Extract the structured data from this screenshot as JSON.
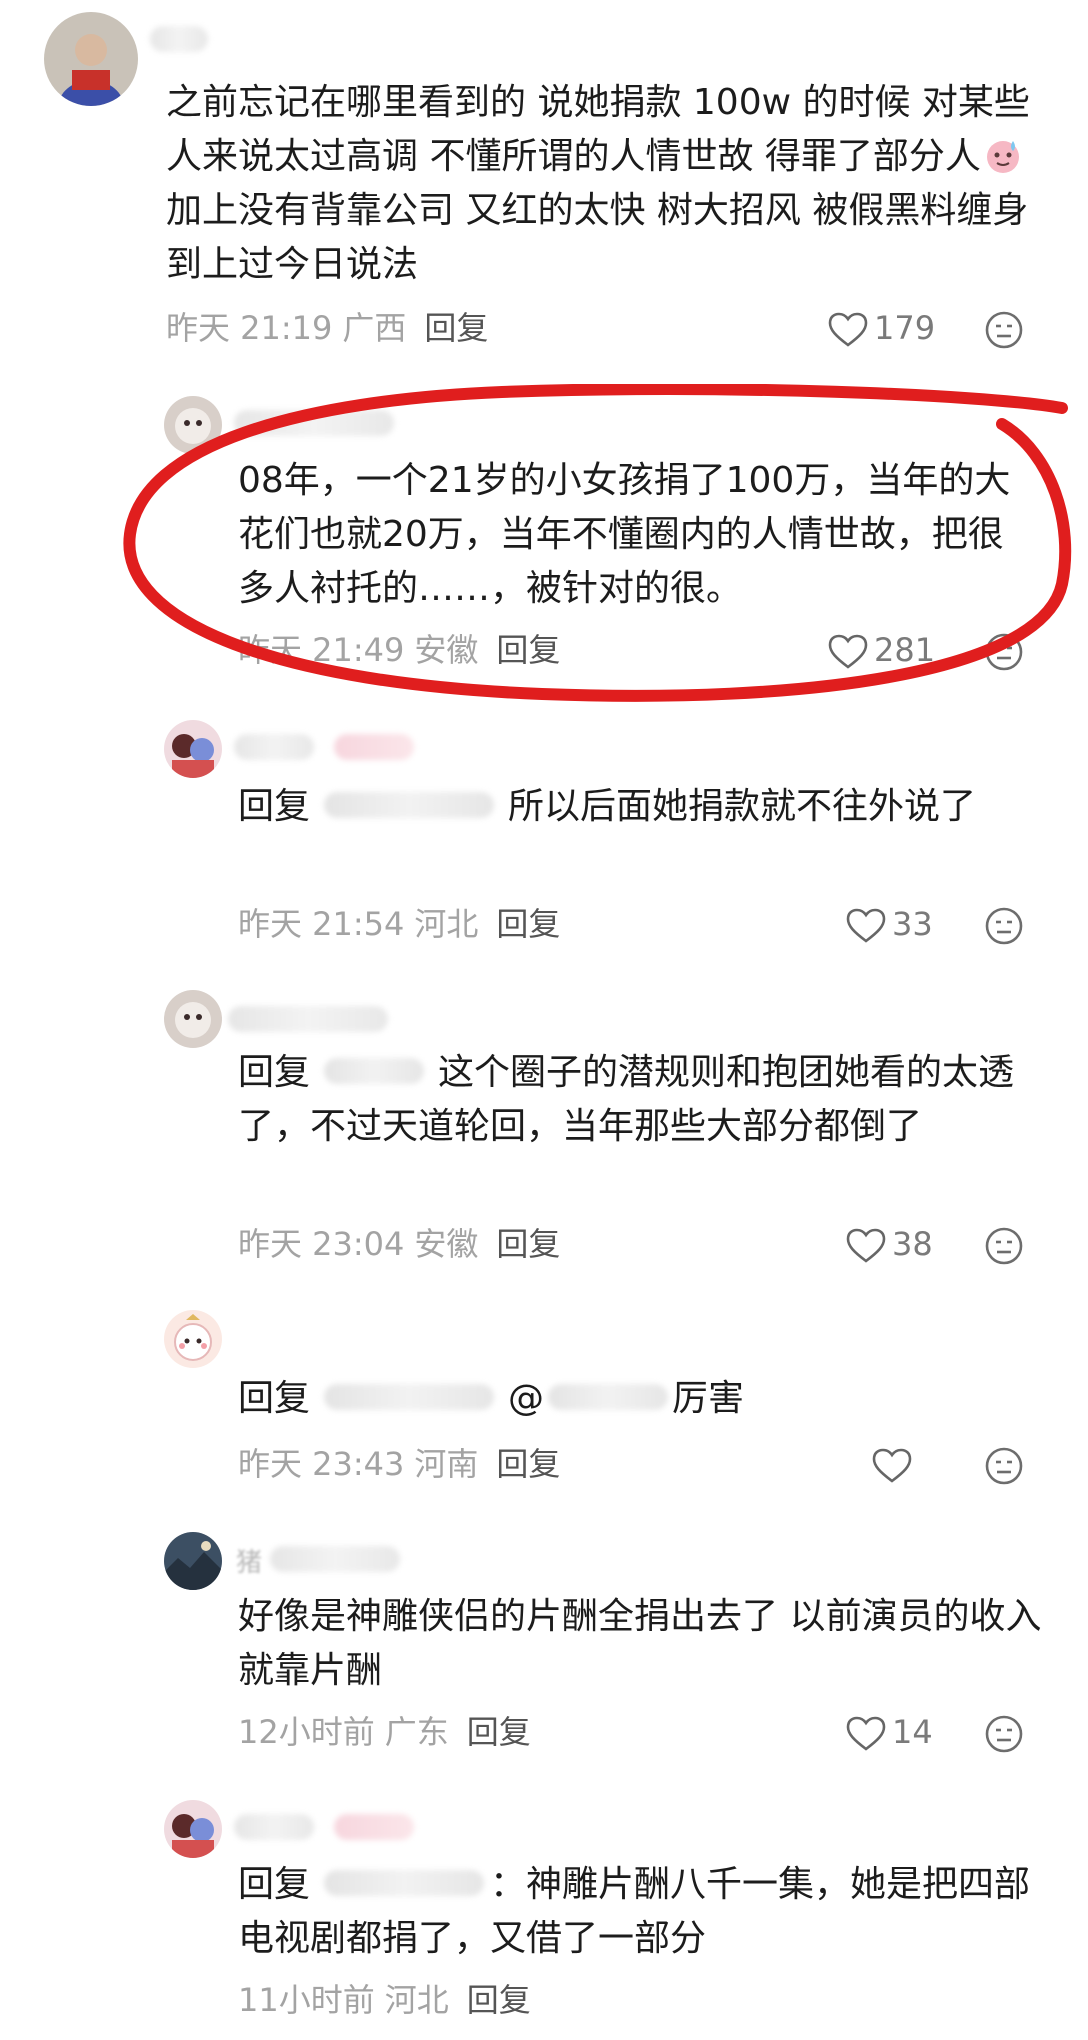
{
  "comments": [
    {
      "text": "之前忘记在哪里看到的 说她捐款 100w 的时候 对某些人来说太过高调 不懂所谓的人情世故 得罪了部分人",
      "text_after_emoji": "加上没有背靠公司 又红的太快 树大招风 被假黑料缠身到上过今日说法",
      "emoji": "sweat-smile-emoji",
      "time": "昨天 21:19",
      "location": "广西",
      "reply_label": "回复",
      "likes": "179"
    },
    {
      "text": "08年，一个21岁的小女孩捐了100万，当年的大花们也就20万，当年不懂圈内的人情世故，把很多人衬托的……，被针对的很。",
      "time": "昨天 21:49",
      "location": "安徽",
      "reply_label": "回复",
      "likes": "281"
    },
    {
      "reply_prefix": "回复",
      "text": "所以后面她捐款就不往外说了",
      "time": "昨天 21:54",
      "location": "河北",
      "reply_label": "回复",
      "likes": "33"
    },
    {
      "reply_prefix": "回复",
      "text": "这个圈子的潜规则和抱团她看的太透了，不过天道轮回，当年那些大部分都倒了",
      "time": "昨天 23:04",
      "location": "安徽",
      "reply_label": "回复",
      "likes": "38"
    },
    {
      "reply_prefix": "回复",
      "at": "@",
      "text": "厉害",
      "time": "昨天 23:43",
      "location": "河南",
      "reply_label": "回复",
      "likes": ""
    },
    {
      "name_char": "猪",
      "text": "好像是神雕侠侣的片酬全捐出去了 以前演员的收入就靠片酬",
      "time": "12小时前",
      "location": "广东",
      "reply_label": "回复",
      "likes": "14"
    },
    {
      "reply_prefix": "回复",
      "text": "：神雕片酬八千一集，她是把四部电视剧都捐了，又借了一部分",
      "time": "11小时前",
      "location": "河北",
      "reply_label": "回复",
      "likes": ""
    }
  ],
  "colors": {
    "highlight_circle": "#e01e1e",
    "meta_text": "#a3a3a3",
    "body_text": "#1c1c1c"
  },
  "icons": [
    "heart-icon",
    "emoji-reaction-icon"
  ]
}
